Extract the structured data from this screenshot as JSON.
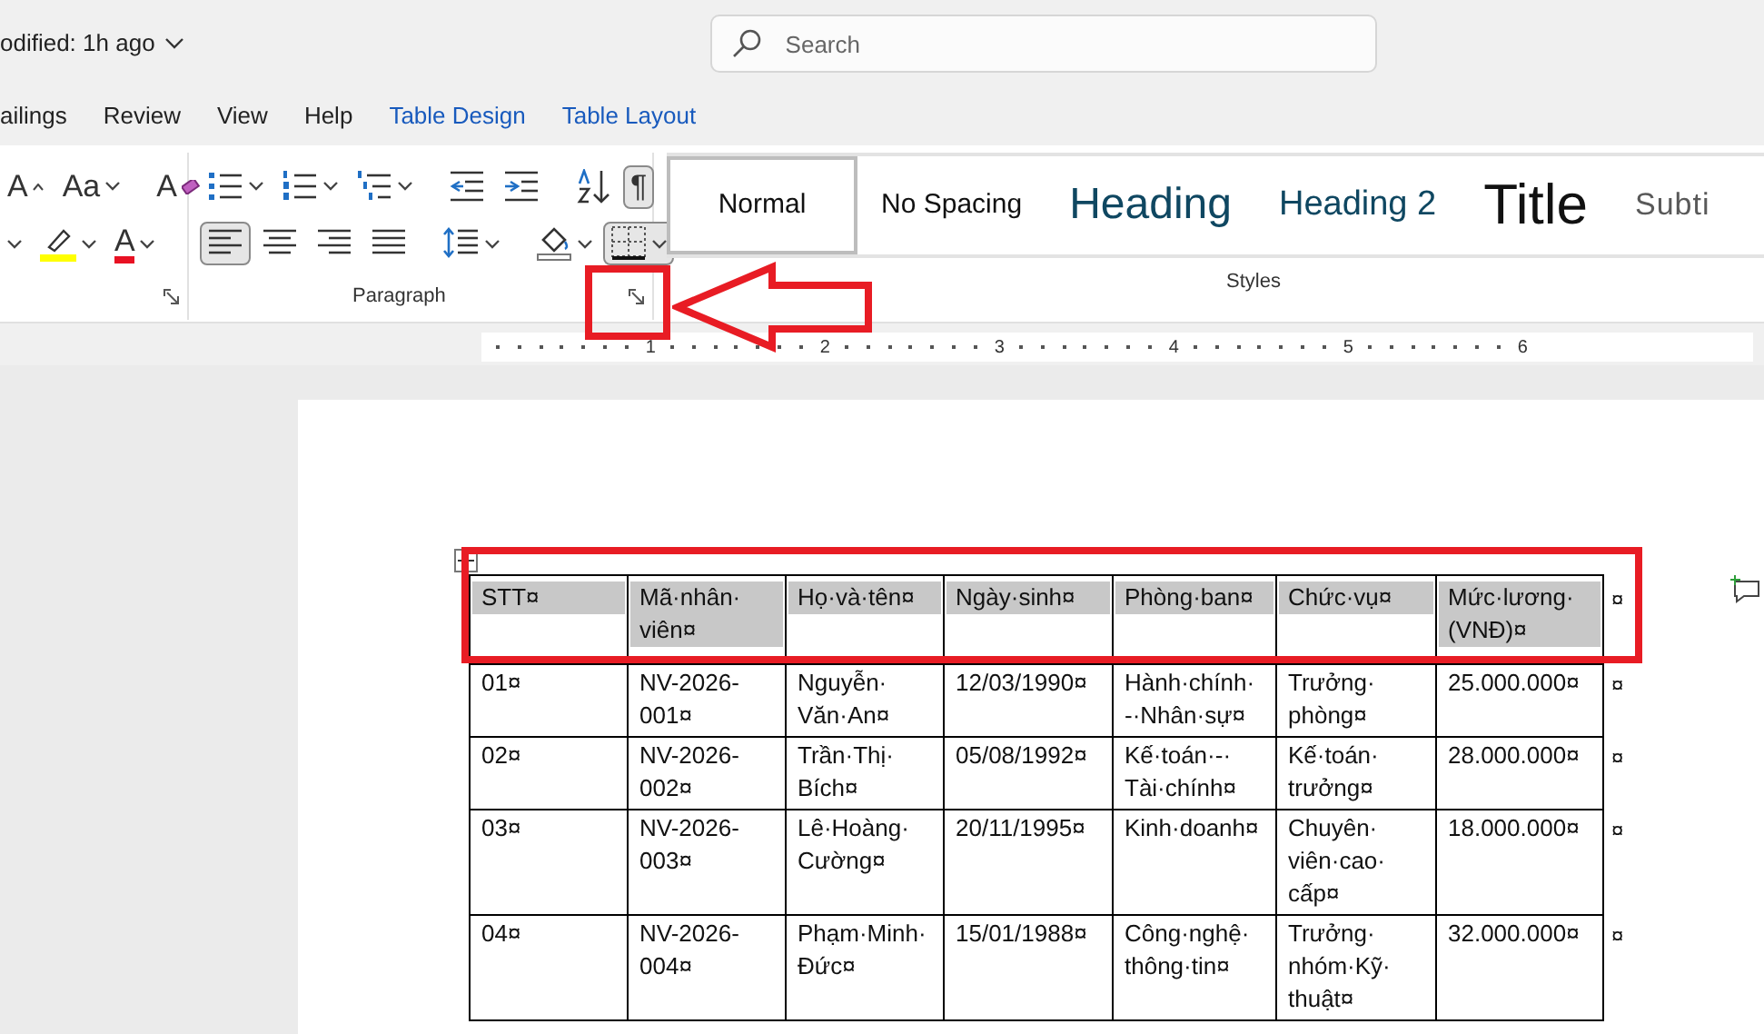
{
  "title_bar": {
    "modified": "odified: 1h ago",
    "search": {
      "placeholder": "Search"
    }
  },
  "menu_tabs": [
    {
      "label": "ailings",
      "kind": "main",
      "selected": false
    },
    {
      "label": "Review",
      "kind": "main",
      "selected": false
    },
    {
      "label": "View",
      "kind": "main",
      "selected": false
    },
    {
      "label": "Help",
      "kind": "main",
      "selected": false
    },
    {
      "label": "Table Design",
      "kind": "contextual",
      "selected": false
    },
    {
      "label": "Table Layout",
      "kind": "contextual",
      "selected": false
    }
  ],
  "ribbon": {
    "font_group": {
      "row1": [
        {
          "kind": "grow",
          "glyph": "A"
        },
        {
          "kind": "case",
          "glyph": "Aa",
          "dropdown": true
        },
        {
          "kind": "clear",
          "glyph": "A"
        }
      ],
      "row2": [
        {
          "kind": "more"
        },
        {
          "kind": "highlight",
          "color": "#ffff00",
          "dropdown": true
        },
        {
          "kind": "font-color",
          "glyph": "A",
          "color": "#e81123",
          "dropdown": true
        }
      ]
    },
    "paragraph_group": {
      "label": "Paragraph",
      "row1": [
        {
          "kind": "bullets",
          "dropdown": true,
          "pressed": false
        },
        {
          "kind": "numbering",
          "dropdown": true,
          "pressed": false
        },
        {
          "kind": "multilevel",
          "dropdown": true,
          "pressed": false
        },
        {
          "kind": "outdent",
          "dropdown": false,
          "pressed": false
        },
        {
          "kind": "indent",
          "dropdown": false,
          "pressed": false
        },
        {
          "kind": "sort",
          "dropdown": false,
          "pressed": false
        },
        {
          "kind": "marks",
          "glyph": "¶",
          "dropdown": false,
          "pressed": true
        }
      ],
      "row2": [
        {
          "kind": "align-left",
          "dropdown": false,
          "pressed": true
        },
        {
          "kind": "align-center",
          "dropdown": false,
          "pressed": false
        },
        {
          "kind": "align-right",
          "dropdown": false,
          "pressed": false
        },
        {
          "kind": "justify",
          "dropdown": false,
          "pressed": false
        },
        {
          "kind": "line-spacing",
          "dropdown": true,
          "pressed": false
        },
        {
          "kind": "shading",
          "dropdown": true,
          "pressed": false
        },
        {
          "kind": "borders",
          "dropdown": true,
          "pressed": true
        }
      ]
    },
    "styles_group": {
      "label": "Styles",
      "styles": [
        {
          "label": "Normal",
          "kind": "normal",
          "selected": true
        },
        {
          "label": "No Spacing",
          "kind": "no-spacing",
          "selected": false
        },
        {
          "label": "Heading",
          "kind": "heading-1",
          "selected": false
        },
        {
          "label": "Heading 2",
          "kind": "heading-2",
          "selected": false
        },
        {
          "label": "Title",
          "kind": "title",
          "selected": false
        },
        {
          "label": "Subti",
          "kind": "subtitle",
          "selected": false
        }
      ]
    }
  },
  "ruler": {
    "labels": [
      "1",
      "2",
      "3",
      "4",
      "5",
      "6"
    ]
  },
  "document": {
    "table": {
      "columns": [
        "STT¤",
        "Mã·nhân·viên¤",
        "Họ·và·tên¤",
        "Ngày·sinh¤",
        "Phòng·ban¤",
        "Chức·vụ¤",
        "Mức·lương·(VNĐ)¤"
      ],
      "header_end_mark": "¤",
      "rows": [
        {
          "cells": [
            "01¤",
            "NV-2026-001¤",
            "Nguyễn·Văn·An¤",
            "12/03/1990¤",
            "Hành·chính·-·Nhân·sự¤",
            "Trưởng·phòng¤",
            "25.000.000¤"
          ],
          "end_mark": "¤"
        },
        {
          "cells": [
            "02¤",
            "NV-2026-002¤",
            "Trần·Thị·Bích¤",
            "05/08/1992¤",
            "Kế·toán·-·Tài·chính¤",
            "Kế·toán·trưởng¤",
            "28.000.000¤"
          ],
          "end_mark": "¤"
        },
        {
          "cells": [
            "03¤",
            "NV-2026-003¤",
            "Lê·Hoàng·Cường¤",
            "20/11/1995¤",
            "Kinh·doanh¤",
            "Chuyên·viên·cao·cấp¤",
            "18.000.000¤"
          ],
          "end_mark": "¤"
        },
        {
          "cells": [
            "04¤",
            "NV-2026-004¤",
            "Phạm·Minh·Đức¤",
            "15/01/1988¤",
            "Công·nghệ·thông·tin¤",
            "Trưởng·nhóm·Kỹ·thuật¤",
            "32.000.000¤"
          ],
          "end_mark": "¤"
        }
      ]
    }
  },
  "annotations": [
    {
      "kind": "small-box"
    },
    {
      "kind": "arrow"
    },
    {
      "kind": "wide-box"
    }
  ]
}
